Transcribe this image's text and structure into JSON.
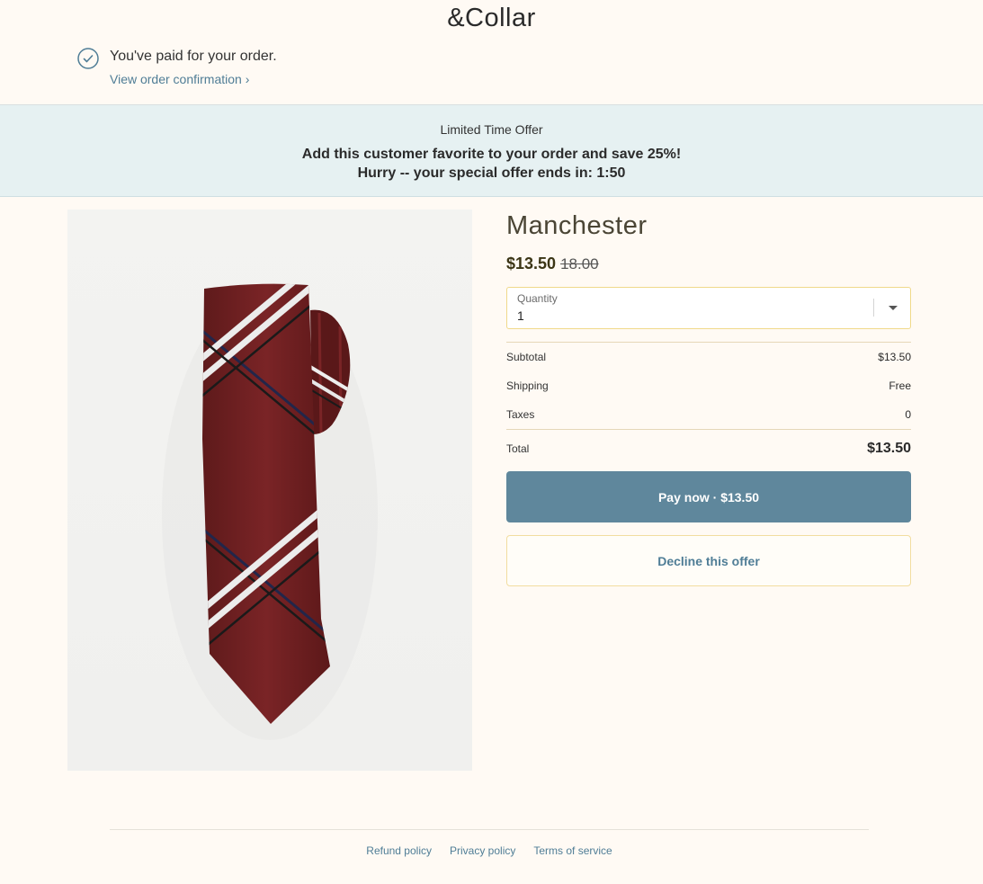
{
  "header": {
    "brand": "&Collar",
    "paid_message": "You've paid for your order.",
    "confirmation_link": "View order confirmation ›"
  },
  "offer": {
    "label": "Limited Time Offer",
    "headline": "Add this customer favorite to your order and save 25%!",
    "timer": "Hurry -- your special offer ends in: 1:50"
  },
  "product": {
    "title": "Manchester",
    "sale_price": "$13.50",
    "original_price": "18.00",
    "image_icon": "necktie-image"
  },
  "quantity": {
    "label": "Quantity",
    "value": "1"
  },
  "summary": {
    "subtotal_label": "Subtotal",
    "subtotal_value": "$13.50",
    "shipping_label": "Shipping",
    "shipping_value": "Free",
    "taxes_label": "Taxes",
    "taxes_value": "0",
    "total_label": "Total",
    "total_value": "$13.50"
  },
  "actions": {
    "pay_label": "Pay now · $13.50",
    "decline_label": "Decline this offer"
  },
  "footer": {
    "links": [
      "Refund policy",
      "Privacy policy",
      "Terms of service"
    ]
  },
  "colors": {
    "accent": "#5f879c",
    "link": "#4f7d96",
    "banner_bg": "#e6f1f2",
    "page_bg": "#fffaf4",
    "tie": "#6e1f20"
  }
}
